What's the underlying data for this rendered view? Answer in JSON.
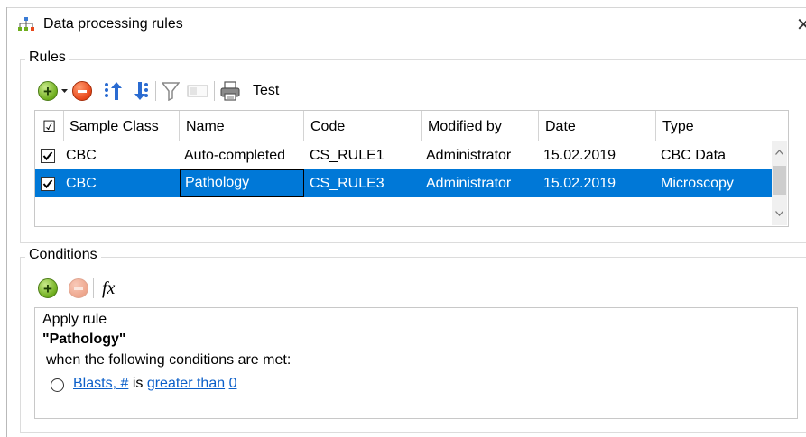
{
  "window": {
    "title": "Data processing rules",
    "close_glyph": "✕"
  },
  "rules_group": {
    "label": "Rules",
    "toolbar": {
      "add": "add-icon",
      "remove": "remove-icon",
      "move_up": "move-up-icon",
      "move_down": "move-down-icon",
      "filter": "filter-icon",
      "field": "field-icon",
      "print": "print-icon",
      "test_label": "Test"
    },
    "columns": [
      "Sample Class",
      "Name",
      "Code",
      "Modified by",
      "Date",
      "Type"
    ],
    "header_check": "☑",
    "rows": [
      {
        "checked": true,
        "sample_class": "CBC",
        "name": "Auto-completed",
        "code": "CS_RULE1",
        "modified_by": "Administrator",
        "date": "15.02.2019",
        "type": "CBC Data",
        "selected": false
      },
      {
        "checked": true,
        "sample_class": "CBC",
        "name": "Pathology",
        "code": "CS_RULE3",
        "modified_by": "Administrator",
        "date": "15.02.2019",
        "type": "Microscopy",
        "selected": true
      }
    ]
  },
  "conditions_group": {
    "label": "Conditions",
    "fx_label": "fx",
    "apply_rule": "Apply rule",
    "rule_name": "\"Pathology\"",
    "when_text": "when the following conditions are met:",
    "condition": {
      "field": "Blasts, #",
      "is": "is",
      "operator": "greater than",
      "value": "0"
    }
  },
  "colors": {
    "selection": "#0078d7",
    "link": "#0b5fc9",
    "add_green": "#6fae1e",
    "remove_red": "#e8471a"
  }
}
